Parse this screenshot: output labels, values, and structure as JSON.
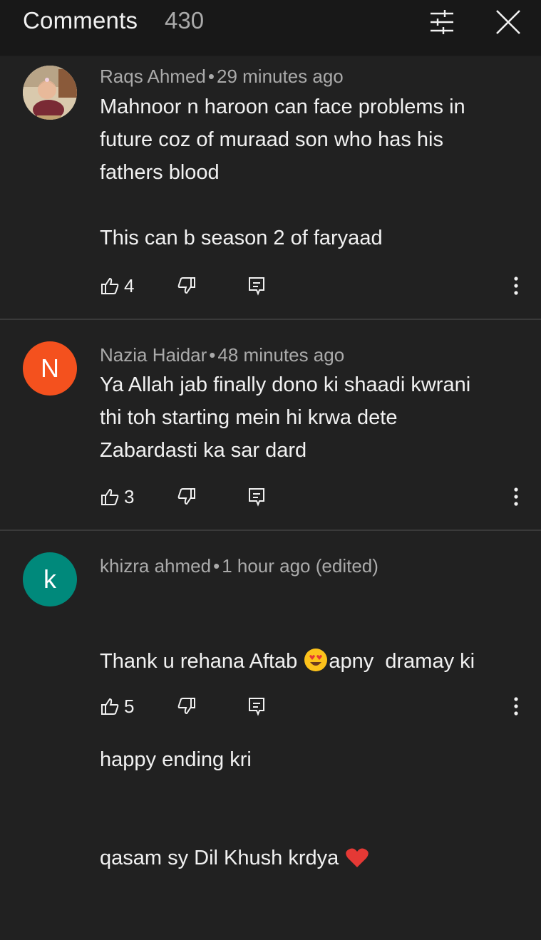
{
  "header": {
    "title": "Comments",
    "count": "430",
    "filter_icon": "sliders-icon",
    "close_icon": "close-icon"
  },
  "comments": [
    {
      "author": "Raqs Ahmed",
      "time": "29 minutes ago",
      "edited": "",
      "text": "Mahnoor n haroon can face problems in\nfuture coz of muraad son who has his\nfathers blood\n\nThis can b season 2 of faryaad",
      "likes": "4",
      "avatar_type": "photo"
    },
    {
      "author": "Nazia Haidar",
      "time": "48 minutes ago",
      "edited": "",
      "text": "Ya Allah jab finally dono ki shaadi kwrani\nthi toh starting mein hi krwa dete\nZabardasti ka sar dard",
      "likes": "3",
      "avatar_letter": "N",
      "avatar_color": "#f4511e"
    },
    {
      "author": "khizra ahmed",
      "time": "1 hour ago",
      "edited": "(edited)",
      "text_line1_a": "Thank u rehana Aftab ",
      "text_line1_b": "apny  dramay ki",
      "text_line2": "happy ending kri",
      "text_line3": "qasam sy Dil Khush krdya ",
      "likes": "5",
      "avatar_letter": "k",
      "avatar_color": "#00897b"
    }
  ],
  "colors": {
    "background": "#212121",
    "header_bg": "#181818",
    "primary_text": "#f1f1f1",
    "secondary_text": "#aaaaaa",
    "divider": "#3a3a3a"
  }
}
